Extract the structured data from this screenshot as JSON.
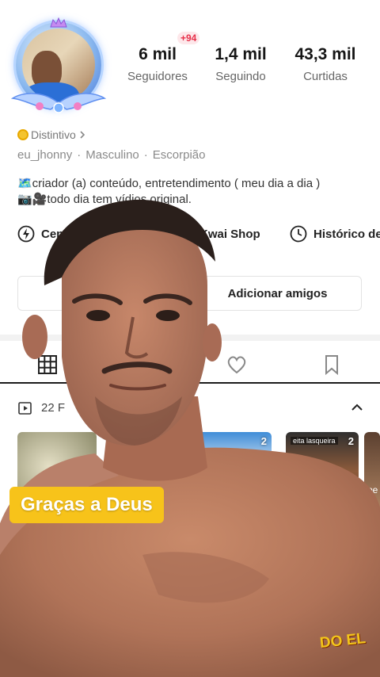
{
  "profile": {
    "stats": [
      {
        "value": "6 mil",
        "label": "Seguidores",
        "badge": "+94"
      },
      {
        "value": "1,4 mil",
        "label": "Seguindo"
      },
      {
        "value": "43,3 mil",
        "label": "Curtidas"
      }
    ],
    "distintivo": "Distintivo",
    "username": "eu_jhonny",
    "gender": "Masculino",
    "sign": "Escorpião",
    "bio_line1": "🗺️criador (a) conteúdo, entretendimento ( meu dia a dia )",
    "bio_line2": "📷🎥todo dia tem vídios original."
  },
  "shortcuts": [
    {
      "label": "Cent",
      "icon": "lightning-icon"
    },
    {
      "label": "Kwai Shop",
      "icon": "shop-icon"
    },
    {
      "label": "Histórico de",
      "icon": "clock-icon"
    }
  ],
  "actions": {
    "add_friends": "Adicionar amigos"
  },
  "tabs": [
    {
      "name": "grid-icon"
    },
    {
      "name": "heart-icon"
    },
    {
      "name": "bookmark-icon"
    }
  ],
  "works": {
    "count_text": "22 F"
  },
  "thumbnails": [
    {
      "count": ""
    },
    {
      "count": "2"
    },
    {
      "count": "2",
      "caption": "eita lasqueira"
    },
    {
      "count": "",
      "side_text_1": "pe",
      "side_text_2": "pe"
    }
  ],
  "overlay": {
    "sticker_text": "Graças a Deus",
    "corner_text": "DO EL"
  },
  "colors": {
    "accent_red": "#e7304a",
    "sticker_yellow": "#f7c31a",
    "coin_gold": "#f4c430"
  }
}
